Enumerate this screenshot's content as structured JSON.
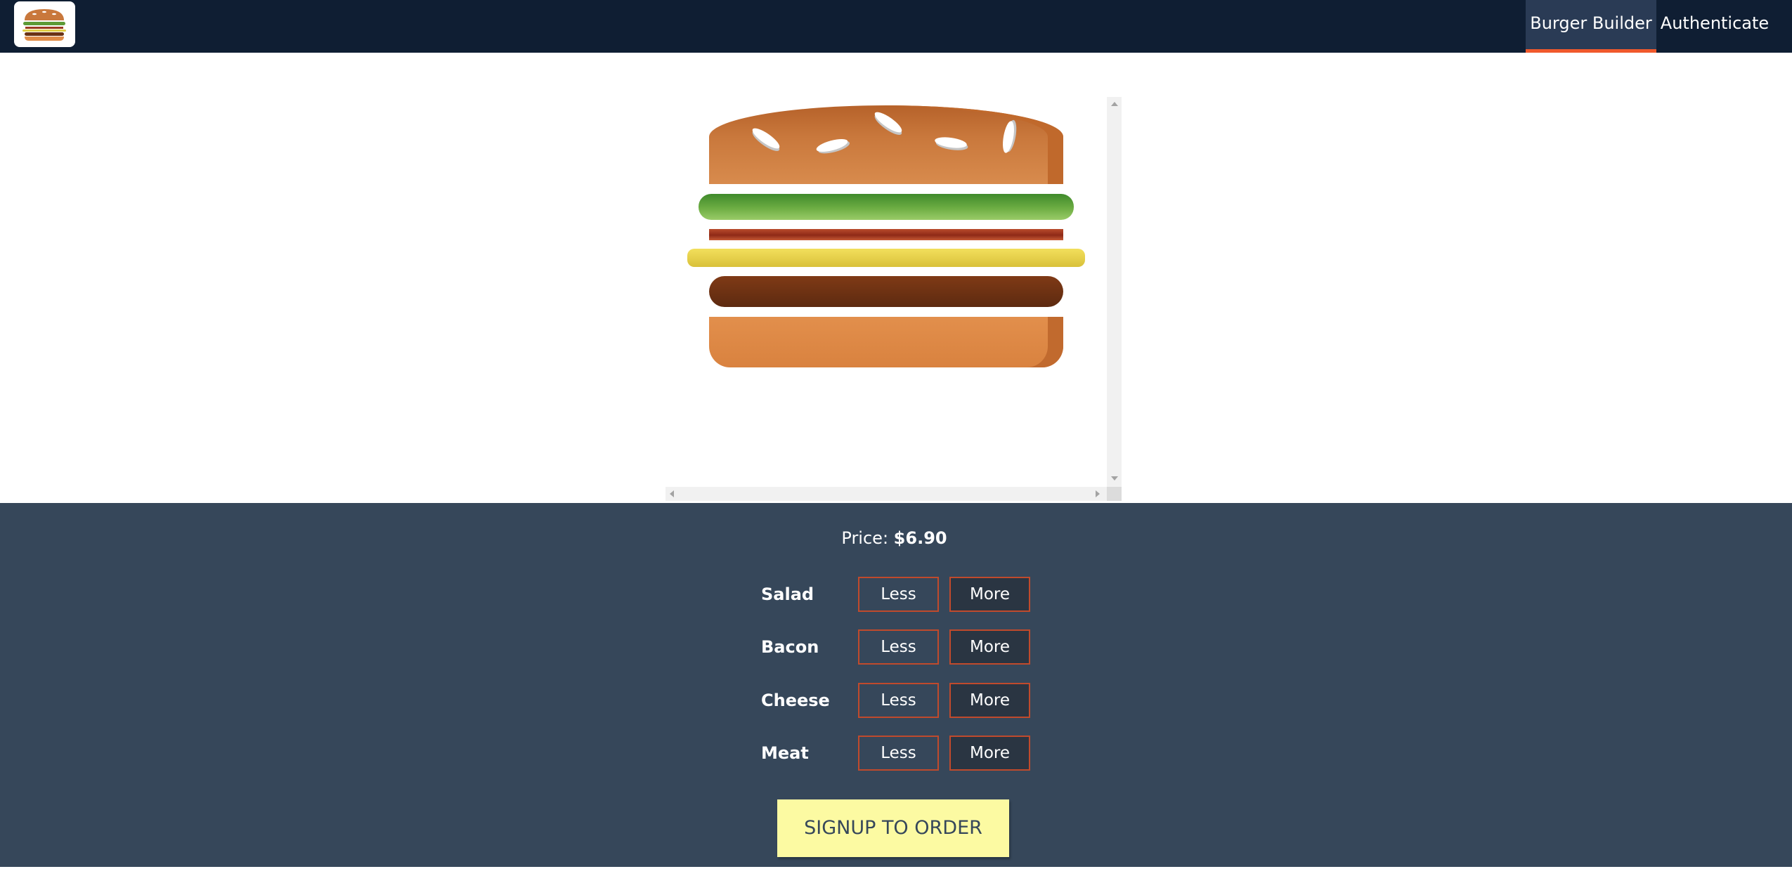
{
  "toolbar": {
    "logo_icon": "burger-logo-icon",
    "nav": [
      {
        "label": "Burger Builder",
        "active": true
      },
      {
        "label": "Authenticate",
        "active": false
      }
    ],
    "colors": {
      "background": "#0f1e33",
      "active_item": "#2a3b55",
      "active_underline": "#f0592c"
    }
  },
  "burger": {
    "ingredients": [
      "bread-top",
      "salad",
      "bacon",
      "cheese",
      "meat",
      "bread-bottom"
    ]
  },
  "build_controls": {
    "price_label": "Price:",
    "price_value": "$6.90",
    "controls": [
      {
        "label": "Salad",
        "less_label": "Less",
        "more_label": "More"
      },
      {
        "label": "Bacon",
        "less_label": "Less",
        "more_label": "More"
      },
      {
        "label": "Cheese",
        "less_label": "Less",
        "more_label": "More"
      },
      {
        "label": "Meat",
        "less_label": "Less",
        "more_label": "More"
      }
    ],
    "order_button": "SIGNUP TO ORDER",
    "colors": {
      "background": "#36475a",
      "button_border": "#c04a2c",
      "order_button": "#fcfaa2"
    }
  }
}
